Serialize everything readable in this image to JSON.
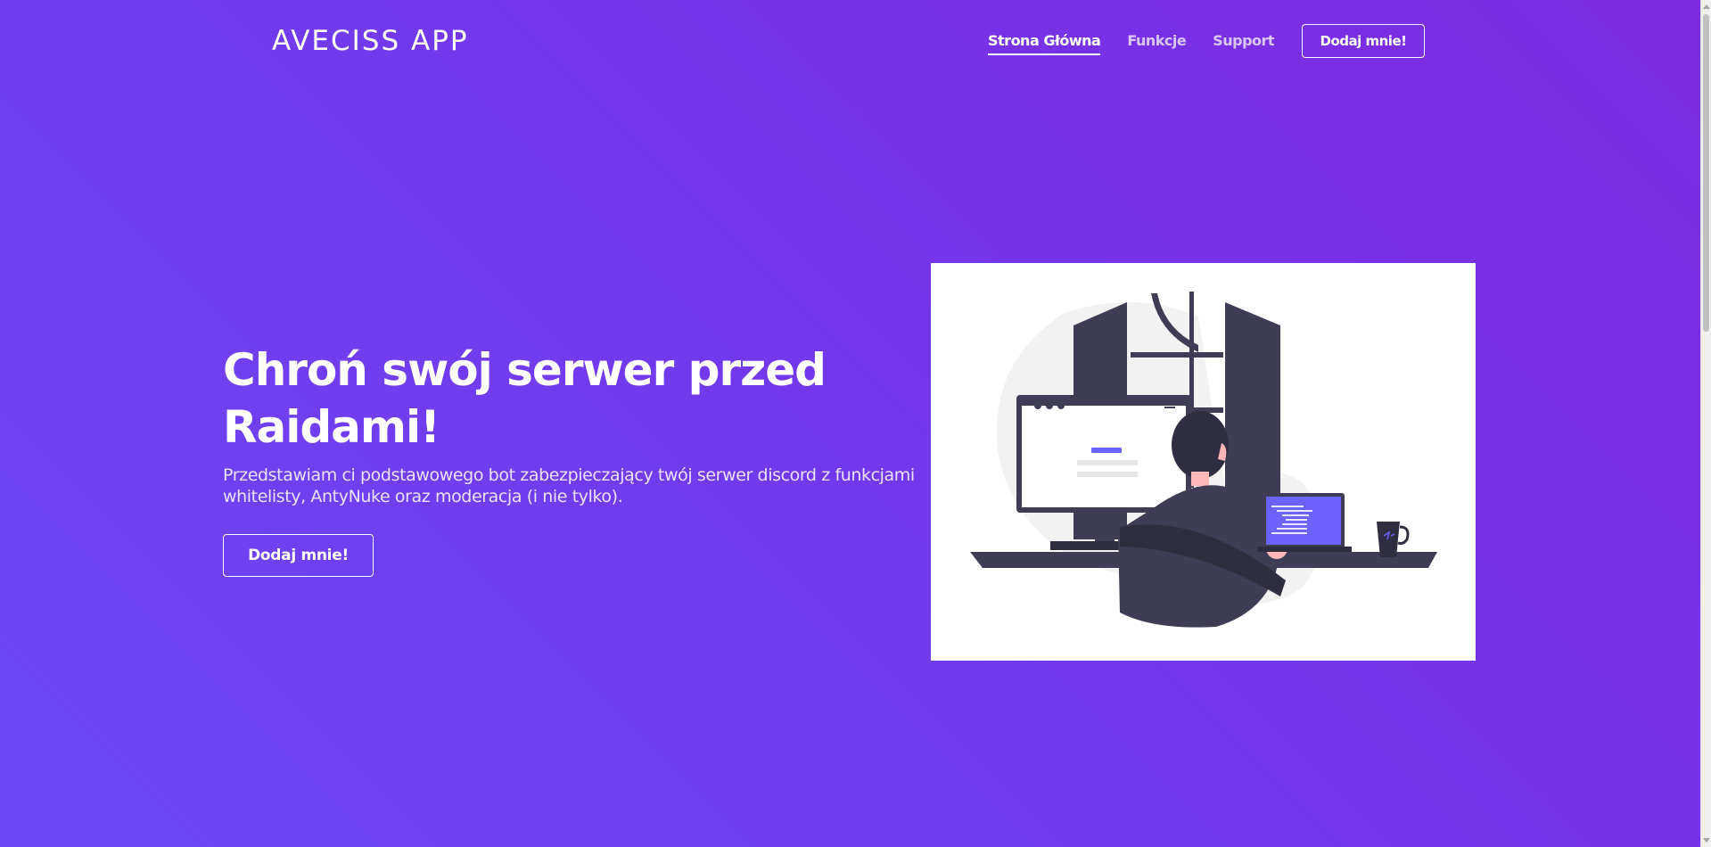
{
  "brand": {
    "name": "AVECISS APP"
  },
  "nav": {
    "items": [
      {
        "label": "Strona Główna",
        "active": true
      },
      {
        "label": "Funkcje",
        "active": false
      },
      {
        "label": "Support",
        "active": false
      }
    ],
    "cta_label": "Dodaj mnie!"
  },
  "hero": {
    "title": "Chroń swój serwer przed Raidami!",
    "description": "Przedstawiam ci podstawowego bot zabezpieczający twój serwer discord z funkcjami whitelisty, AntyNuke oraz moderacja (i nie tylko).",
    "cta_label": "Dodaj mnie!"
  },
  "colors": {
    "gradient_start": "#6a48f5",
    "gradient_end": "#7d2ae0",
    "illustration_accent": "#6c63ff",
    "illustration_dark": "#3f3d56"
  },
  "icons": {
    "illustration": "developer-at-desk-illustration"
  }
}
